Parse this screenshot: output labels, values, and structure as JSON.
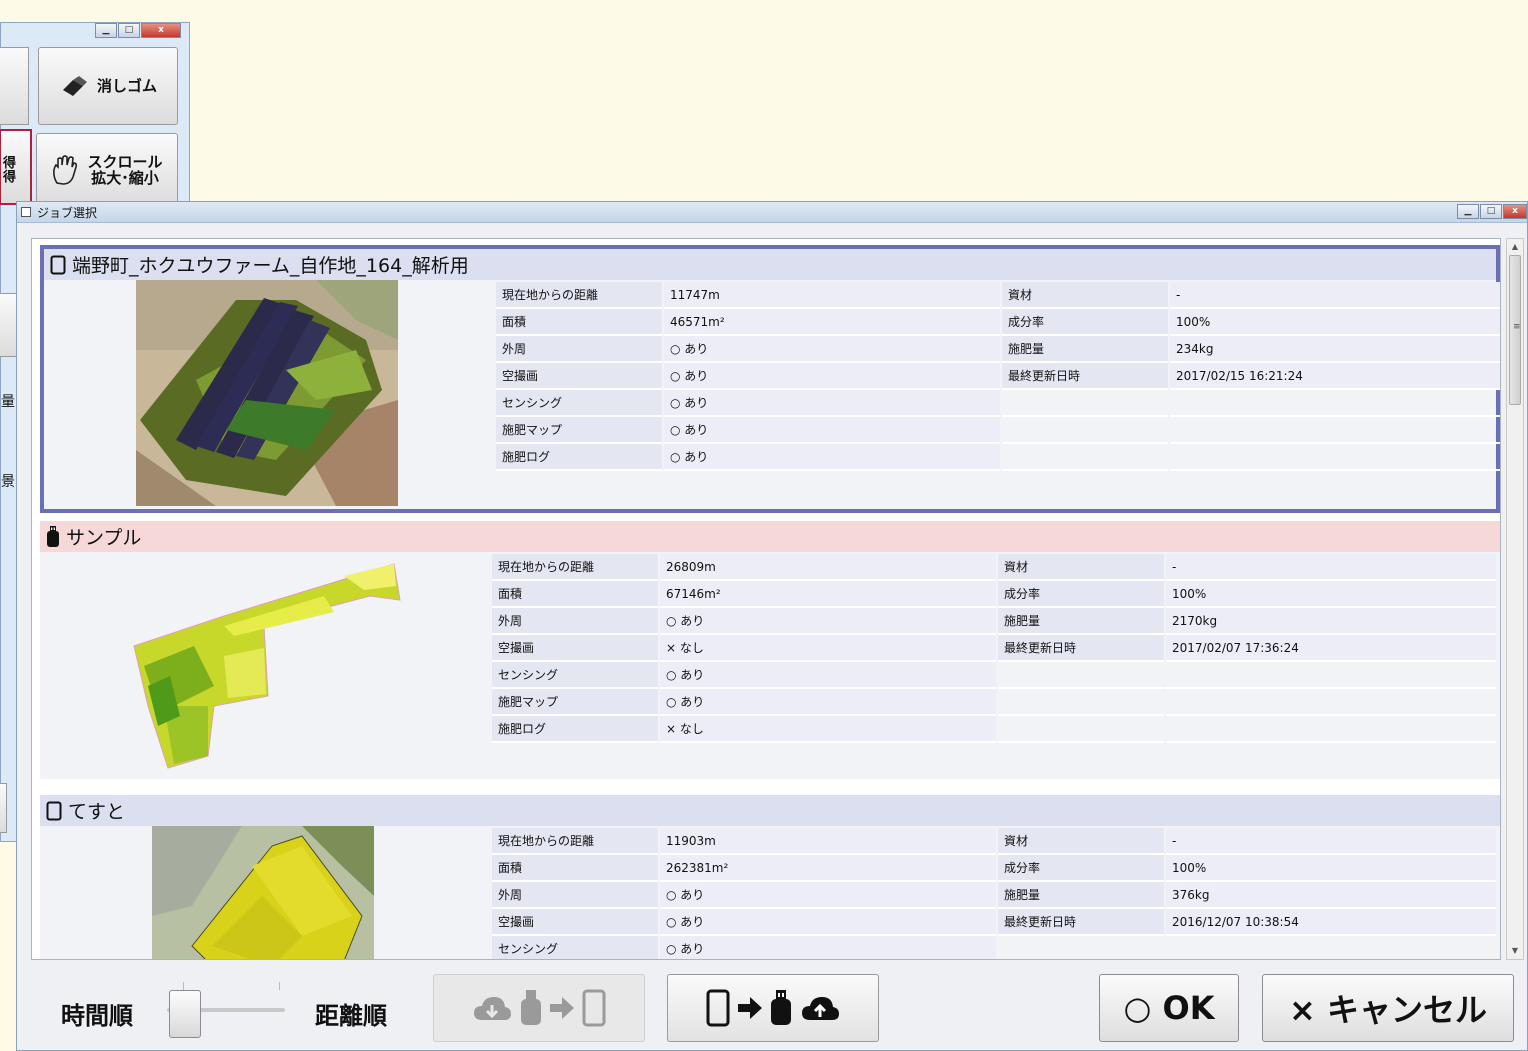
{
  "background_window": {
    "buttons": {
      "eraser": "消しゴム",
      "scroll": "スクロール\n拡大･縮小"
    },
    "partial_labels": [
      "量",
      "景"
    ]
  },
  "dialog": {
    "title": "ジョブ選択",
    "jobs": [
      {
        "name": "端野町_ホクユウファーム_自作地_164_解析用",
        "source": "device",
        "selected": true,
        "left": [
          {
            "key": "現在地からの距離",
            "value": "11747m"
          },
          {
            "key": "面積",
            "value": "46571m²"
          },
          {
            "key": "外周",
            "value": "○ あり"
          },
          {
            "key": "空撮画",
            "value": "○ あり"
          },
          {
            "key": "センシング",
            "value": "○ あり"
          },
          {
            "key": "施肥マップ",
            "value": "○ あり"
          },
          {
            "key": "施肥ログ",
            "value": "○ あり"
          }
        ],
        "right": [
          {
            "key": "資材",
            "value": "-"
          },
          {
            "key": "成分率",
            "value": "100%"
          },
          {
            "key": "施肥量",
            "value": "234kg"
          },
          {
            "key": "最終更新日時",
            "value": "2017/02/15 16:21:24"
          }
        ]
      },
      {
        "name": "サンプル",
        "source": "usb",
        "selected": false,
        "left": [
          {
            "key": "現在地からの距離",
            "value": "26809m"
          },
          {
            "key": "面積",
            "value": "67146m²"
          },
          {
            "key": "外周",
            "value": "○ あり"
          },
          {
            "key": "空撮画",
            "value": "× なし"
          },
          {
            "key": "センシング",
            "value": "○ あり"
          },
          {
            "key": "施肥マップ",
            "value": "○ あり"
          },
          {
            "key": "施肥ログ",
            "value": "× なし"
          }
        ],
        "right": [
          {
            "key": "資材",
            "value": "-"
          },
          {
            "key": "成分率",
            "value": "100%"
          },
          {
            "key": "施肥量",
            "value": "2170kg"
          },
          {
            "key": "最終更新日時",
            "value": "2017/02/07 17:36:24"
          }
        ]
      },
      {
        "name": "てすと",
        "source": "device",
        "selected": false,
        "left": [
          {
            "key": "現在地からの距離",
            "value": "11903m"
          },
          {
            "key": "面積",
            "value": "262381m²"
          },
          {
            "key": "外周",
            "value": "○ あり"
          },
          {
            "key": "空撮画",
            "value": "○ あり"
          },
          {
            "key": "センシング",
            "value": "○ あり"
          }
        ],
        "right": [
          {
            "key": "資材",
            "value": "-"
          },
          {
            "key": "成分率",
            "value": "100%"
          },
          {
            "key": "施肥量",
            "value": "376kg"
          },
          {
            "key": "最終更新日時",
            "value": "2016/12/07 10:38:54"
          }
        ]
      }
    ],
    "sort": {
      "time_label": "時間順",
      "distance_label": "距離順",
      "position": 0
    },
    "ok_label": "○ OK",
    "cancel_label": "× キャンセル",
    "colors": {
      "selected_border": "#6b6fb8",
      "header_device": "#dcdff0",
      "header_usb": "#f7d8d8"
    }
  }
}
